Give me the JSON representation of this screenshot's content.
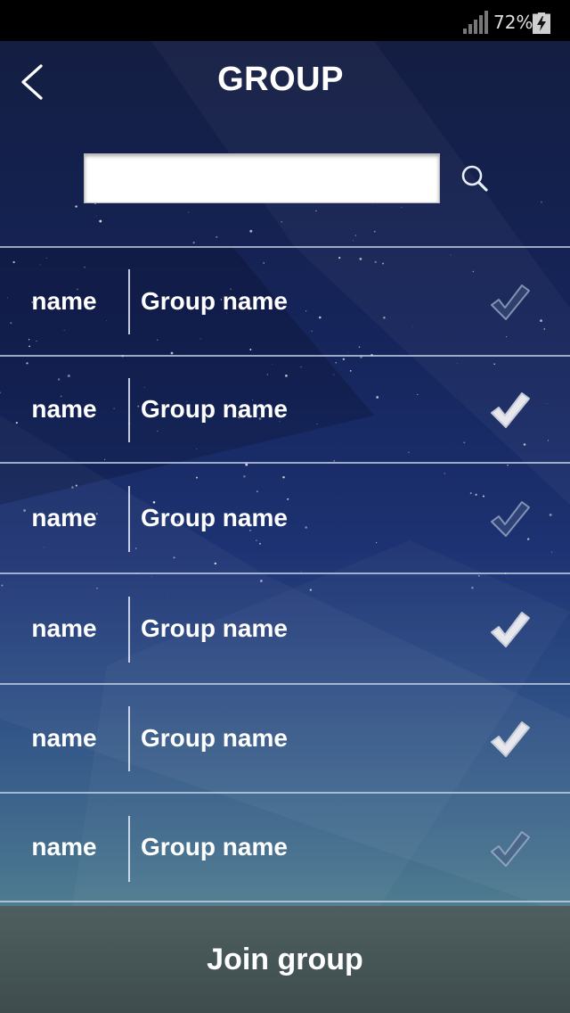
{
  "status_bar": {
    "battery_percent": "72%",
    "signal_icon": "signal-bars-icon",
    "battery_icon": "battery-charging-icon"
  },
  "header": {
    "title": "GROUP",
    "back_icon": "chevron-left-icon"
  },
  "search": {
    "value": "",
    "placeholder": "",
    "icon": "search-icon"
  },
  "groups": [
    {
      "name": "name",
      "group_name": "Group name",
      "checked": false
    },
    {
      "name": "name",
      "group_name": "Group name",
      "checked": true
    },
    {
      "name": "name",
      "group_name": "Group name",
      "checked": false
    },
    {
      "name": "name",
      "group_name": "Group name",
      "checked": true
    },
    {
      "name": "name",
      "group_name": "Group name",
      "checked": true
    },
    {
      "name": "name",
      "group_name": "Group name",
      "checked": false
    }
  ],
  "footer": {
    "join_label": "Join group"
  },
  "colors": {
    "background_top": "#141e42",
    "background_bottom": "#5a8890",
    "footer": "#465556",
    "text": "#ffffff",
    "check_active": "#e6e8ee"
  }
}
